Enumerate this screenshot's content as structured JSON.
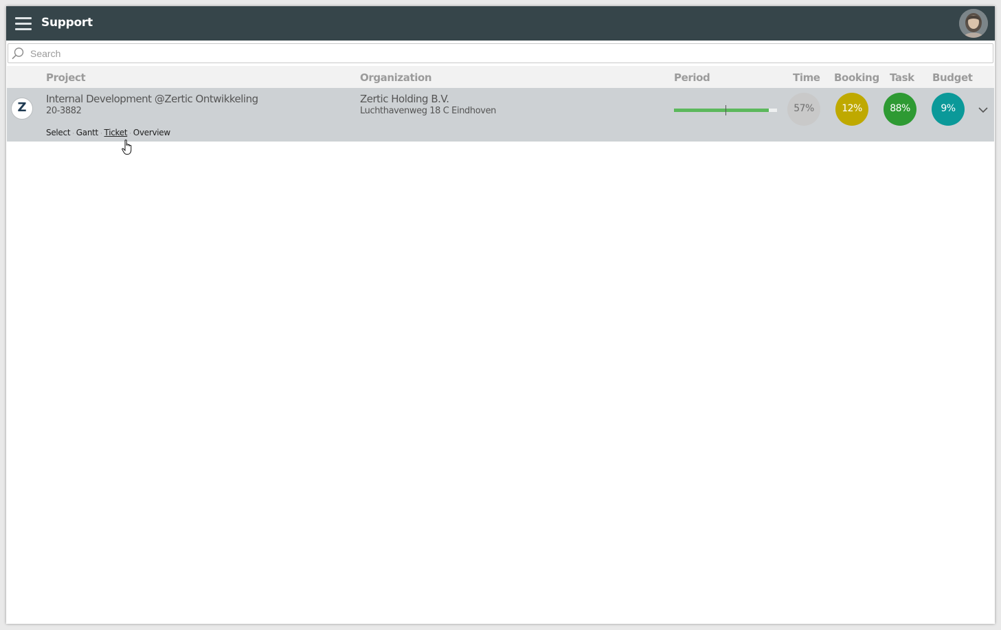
{
  "app": {
    "title": "Support"
  },
  "icons": {
    "menu": "hamburger-menu-icon",
    "search": "search-icon",
    "expand": "chevron-down-icon",
    "user": "avatar"
  },
  "search": {
    "placeholder": "Search",
    "value": ""
  },
  "table": {
    "headers": {
      "project": "Project",
      "organization": "Organization",
      "period": "Period",
      "time": "Time",
      "booking": "Booking",
      "task": "Task",
      "budget": "Budget"
    },
    "rows": [
      {
        "logo_letter": "Z",
        "project_name": "Internal Development @Zertic Ontwikkeling",
        "project_code": "20-3882",
        "organization_name": "Zertic Holding B.V.",
        "organization_address": "Luchthavenweg 18 C Eindhoven",
        "period_progress": 0.92,
        "period_today": 0.5,
        "time": "57%",
        "booking": "12%",
        "task": "88%",
        "budget": "9%",
        "actions": [
          "Select",
          "Gantt",
          "Ticket",
          "Overview"
        ]
      }
    ]
  },
  "colors": {
    "topbar": "#36454a",
    "row_bg": "#cdd1d4",
    "time": "#c9c9c9",
    "booking": "#bfa900",
    "task": "#2e9a33",
    "budget": "#0b9999",
    "period": "#5cb85c"
  }
}
